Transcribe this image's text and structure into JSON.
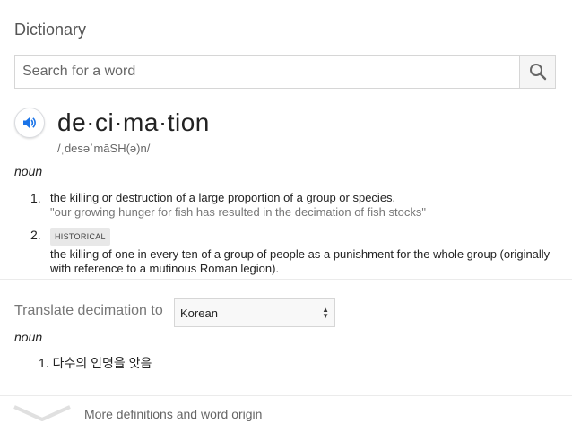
{
  "panel": {
    "title": "Dictionary",
    "search": {
      "placeholder": "Search for a word",
      "value": ""
    }
  },
  "entry": {
    "word": "de·ci·ma·tion",
    "phonetic": "/ˌdesəˈmāSH(ə)n/",
    "part_of_speech": "noun",
    "senses": [
      {
        "number": "1.",
        "definition": "the killing or destruction of a large proportion of a group or species.",
        "example": "\"our growing hunger for fish has resulted in the decimation of fish stocks\""
      },
      {
        "number": "2.",
        "tag": "HISTORICAL",
        "definition": "the killing of one in every ten of a group of people as a punishment for the whole group (originally with reference to a mutinous Roman legion)."
      }
    ]
  },
  "translate": {
    "label": "Translate decimation to",
    "language": "Korean",
    "part_of_speech": "noun",
    "items": [
      {
        "number": "1.",
        "text": "다수의 인명을 앗음"
      }
    ]
  },
  "footer": {
    "more_label": "More definitions and word origin"
  },
  "colors": {
    "accent": "#1a73e8",
    "divider": "#ebebeb"
  },
  "icons": {
    "search": "search-icon",
    "audio": "speaker-icon",
    "expand": "chevron-down-icon"
  }
}
